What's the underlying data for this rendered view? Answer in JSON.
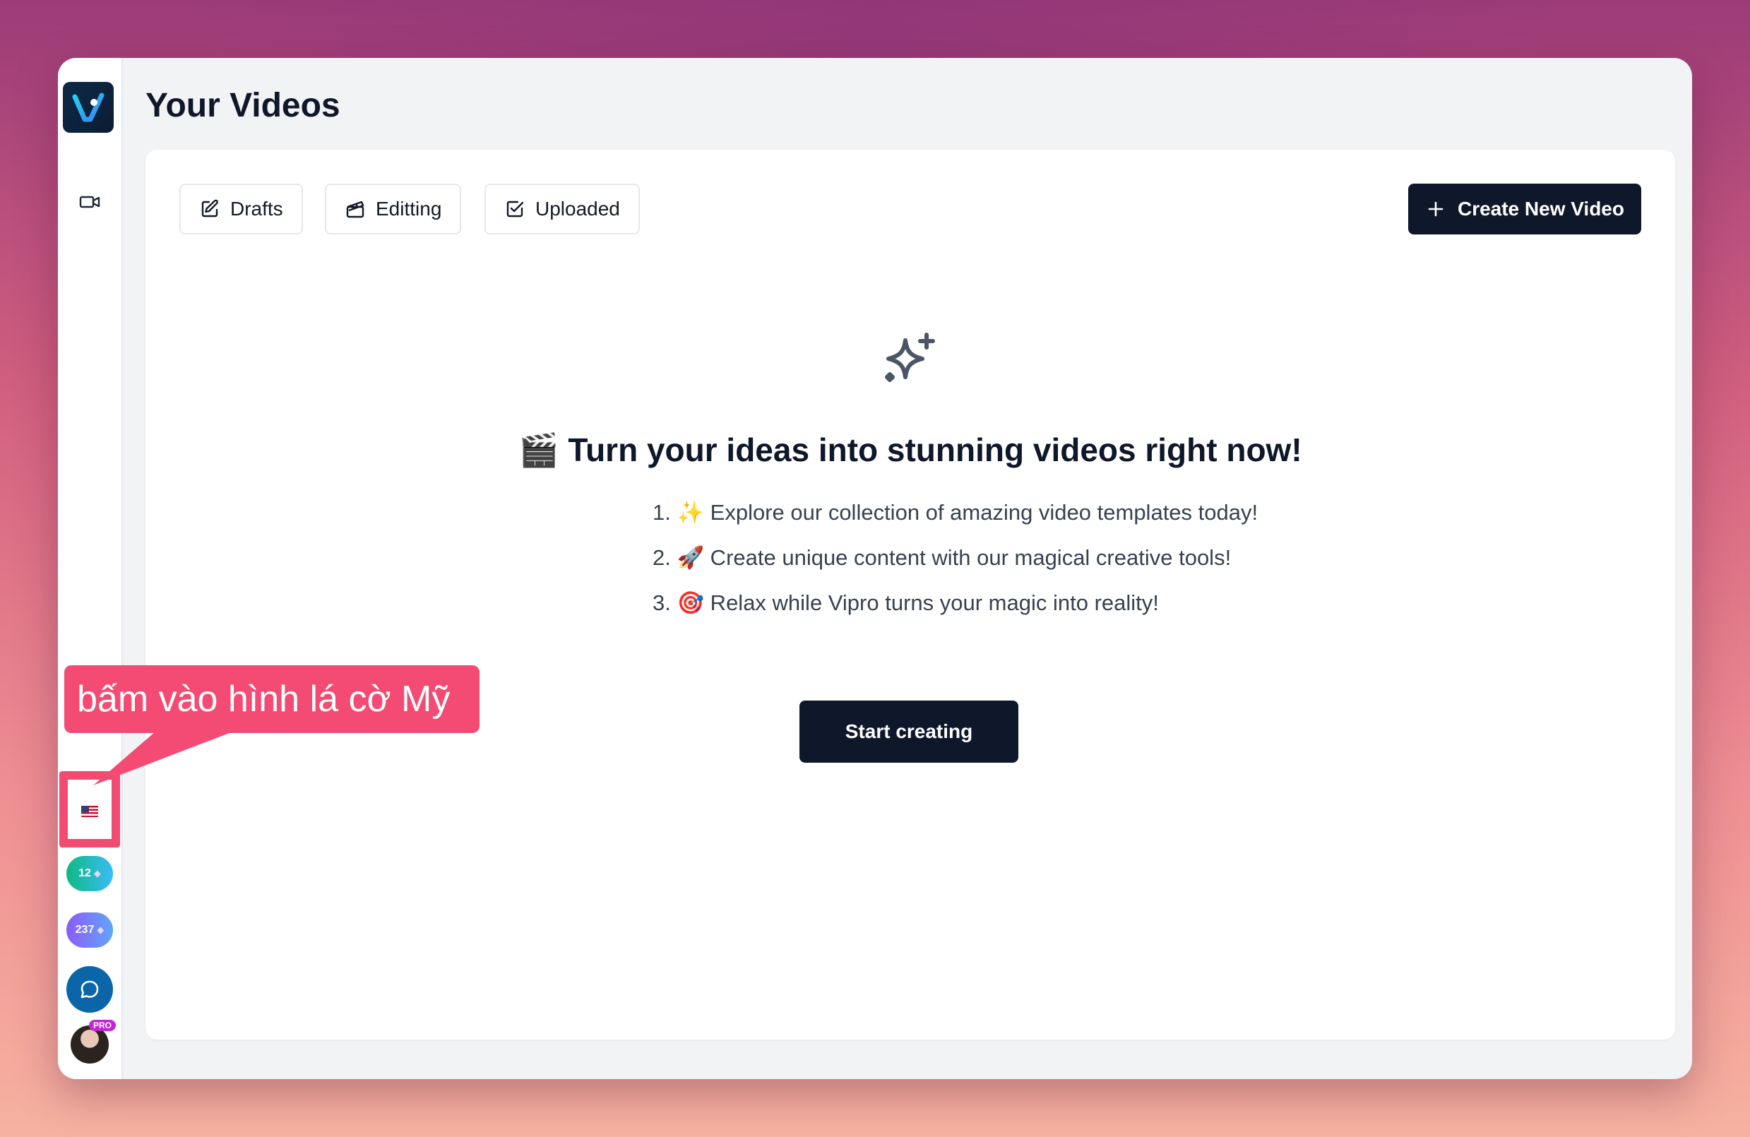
{
  "app": {
    "page_title": "Your Videos",
    "logo_icon": "vipro-logo-icon"
  },
  "sidebar": {
    "videos_icon": "video-camera-icon",
    "language_flag": "us-flag-icon",
    "credits": [
      {
        "value": "12",
        "icon": "gem-icon",
        "color": "#10b981"
      },
      {
        "value": "237",
        "icon": "gem-icon",
        "color": "#8b5cf6"
      }
    ],
    "chat_icon": "chat-bubble-icon",
    "avatar_badge": "PRO"
  },
  "tabs": [
    {
      "label": "Drafts",
      "icon": "edit-icon"
    },
    {
      "label": "Editting",
      "icon": "clapperboard-icon"
    },
    {
      "label": "Uploaded",
      "icon": "check-square-icon"
    }
  ],
  "create_button": {
    "label": "Create New Video",
    "icon": "plus-icon"
  },
  "empty_state": {
    "icon": "sparkles-icon",
    "headline": "🎬 Turn your ideas into stunning videos right now!",
    "steps": [
      "1. ✨ Explore our collection of amazing video templates today!",
      "2. 🚀 Create unique content with our magical creative tools!",
      "3. 🎯 Relax while Vipro turns your magic into reality!"
    ],
    "start_button": "Start creating"
  },
  "annotation": {
    "callout_text": "bấm vào hình lá cờ Mỹ",
    "color": "#f34b73"
  },
  "colors": {
    "primary_dark": "#0f172a",
    "background": "#f2f3f5"
  }
}
